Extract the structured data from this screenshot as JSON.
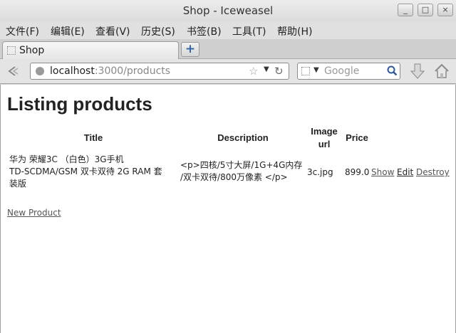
{
  "window": {
    "title": "Shop - Iceweasel",
    "controls": [
      "_",
      "□",
      "×"
    ]
  },
  "menu": [
    "文件(F)",
    "编辑(E)",
    "查看(V)",
    "历史(S)",
    "书签(B)",
    "工具(T)",
    "帮助(H)"
  ],
  "tabs": [
    {
      "label": "Shop",
      "icon": "blank-page-icon"
    }
  ],
  "newtab_label": "+",
  "url": {
    "host": "localhost",
    "path": ":3000/products"
  },
  "search": {
    "placeholder": "Google"
  },
  "page": {
    "heading": "Listing products",
    "columns": {
      "title": "Title",
      "description": "Description",
      "image_url_1": "Image",
      "image_url_2": "url",
      "price": "Price"
    },
    "rows": [
      {
        "title_lines": [
          "华为 荣耀3C （白色）3G手机",
          "TD-SCDMA/GSM 双卡双待 2G RAM 套",
          "装版"
        ],
        "description_lines": [
          "<p>四核/5寸大屏/1G+4G内存",
          "/双卡双待/800万像素 </p>"
        ],
        "image_url": "3c.jpg",
        "price": "899.0",
        "actions": {
          "show": "Show",
          "edit": "Edit",
          "destroy": "Destroy"
        }
      }
    ],
    "new_product_label": "New Product"
  }
}
